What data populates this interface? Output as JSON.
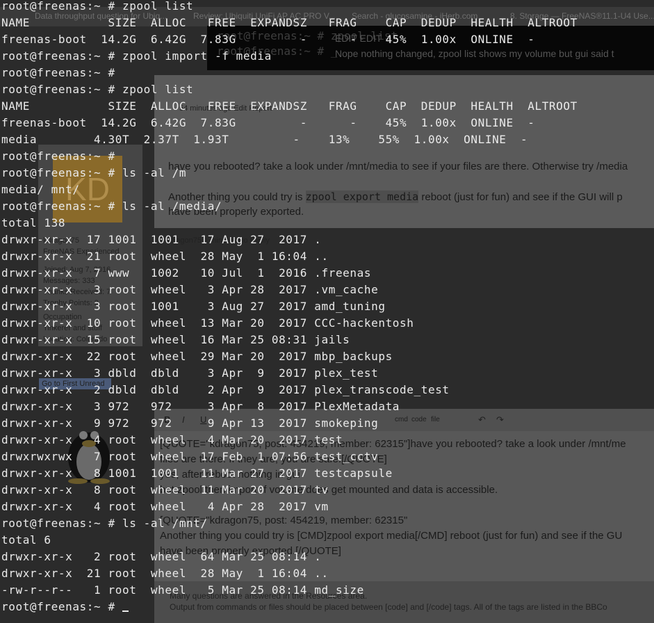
{
  "background_browser": {
    "tabs": [
      "Data throughput question for Ubiq...",
      "Review: Ubiquiti UniFi AP AC PRO V...",
      "Search - glucosamine - iHerb.com",
      "8. Storage — FreeNAS®11.1-U4 Use..."
    ],
    "code_box_lines": [
      "root@freenas:~ # zpool list",
      "root@freenas:~ # _"
    ],
    "edit_note": {
      "title": "EDIT EDIT",
      "text": "Nope nothing changed, zpool list shows my volume but gui said t"
    },
    "post_meta_1": "54 minutes ago  Edit  Report",
    "reply_1": "have you rebooted? take a look under /mnt/media to see if your files are there. Otherwise try /media",
    "reply_2_prefix": "Another thing you could try is",
    "reply_2_code": "zpool export media",
    "reply_2_suffix": "reboot (just for fun) and see if the GUI will p",
    "reply_2_line2": "have been properly exported.",
    "post_meta_2": "kdragon75  1 minute ago  Reply",
    "user_panel": {
      "avatar_letters": "KD",
      "username": "kdragon75",
      "rank": "FreeNAS Experienced",
      "joined": "Joined: Aug 7, 2016",
      "messages": "Messages: 333",
      "thanks": "Thanks Received: 7",
      "trophy": "Trophy Points: 3",
      "occupation": "Occupation",
      "hobby": "Tinkerer and stuff",
      "location": "Location: Colorado"
    },
    "goto_first_unread": "Go to First Unread",
    "editor_toolbar": [
      "B",
      "I",
      "U",
      "cmd",
      "code",
      "file"
    ],
    "editor_lines": [
      "[QUOTE=\"kdragon75, post: 454219, member: 62315\"]have you rebooted? take a look under /mnt/me",
      "files are there. If they are, you are safe.[/QUOTE]",
      "yes, after reboot nothing in gui",
      "but zpool then import -f volume does get mounted and data is accessible.",
      "[QUOTE=\"kdragon75, post: 454219, member: 62315\"",
      "Another thing you could try is [CMD]zpool export media[/CMD] reboot (just for fun) and see if the GU",
      "have been properly exported.[/QUOTE]"
    ],
    "footer_lines": [
      "Many questions are answered in the Resources area.",
      "Output from commands or files should be placed between [code] and [/code] tags. All of the tags are listed in the BBCo"
    ]
  },
  "terminal": {
    "lines": [
      "root@freenas:~ # zpool list",
      "NAME           SIZE  ALLOC   FREE  EXPANDSZ   FRAG    CAP  DEDUP  HEALTH  ALTROOT",
      "freenas-boot  14.2G  6.42G  7.83G         -      -    45%  1.00x  ONLINE  -",
      "root@freenas:~ # zpool import -f media",
      "root@freenas:~ #",
      "root@freenas:~ # zpool list",
      "NAME           SIZE  ALLOC   FREE  EXPANDSZ   FRAG    CAP  DEDUP  HEALTH  ALTROOT",
      "freenas-boot  14.2G  6.42G  7.83G         -      -    45%  1.00x  ONLINE  -",
      "media        4.30T  2.37T  1.93T         -    13%    55%  1.00x  ONLINE  -",
      "root@freenas:~ #",
      "root@freenas:~ # ls -al /m",
      "media/ mnt/",
      "root@freenas:~ # ls -al /media/",
      "total 138",
      "drwxr-xr-x  17 1001  1001   17 Aug 27  2017 .",
      "drwxr-xr-x  21 root  wheel  28 May  1 16:04 ..",
      "drwxr-xr-x   7 www   1002   10 Jul  1  2016 .freenas",
      "drwxr-xr-x   3 root  wheel   3 Apr 28  2017 .vm_cache",
      "drwxr-xr-x   3 root  1001    3 Aug 27  2017 amd_tuning",
      "drwxr-xr-x  10 root  wheel  13 Mar 20  2017 CCC-hackentosh",
      "drwxr-xr-x  15 root  wheel  16 Mar 25 08:31 jails",
      "drwxr-xr-x  22 root  wheel  29 Mar 20  2017 mbp_backups",
      "drwxr-xr-x   3 dbld  dbld    3 Apr  9  2017 plex_test",
      "drwxr-xr-x   2 dbld  dbld    2 Apr  9  2017 plex_transcode_test",
      "drwxr-xr-x   3 972   972     3 Apr  8  2017 PlexMetadata",
      "drwxr-xr-x   9 972   972     9 Apr 13  2017 smokeping",
      "drwxr-xr-x   4 root  wheel   4 Mar 20  2017 test",
      "drwxrwxrwx   7 root  wheel  17 Feb  1 07:56 test_cctv",
      "drwxr-xr-x   8 1001  1001   11 Mar 27  2017 testcapsule",
      "drwxr-xr-x   8 root  wheel  11 Mar 20  2017 tv",
      "drwxr-xr-x   4 root  wheel   4 Apr 28  2017 vm",
      "root@freenas:~ # ls -al /mnt/",
      "total 6",
      "drwxr-xr-x   2 root  wheel  64 Mar 25 08:14 .",
      "drwxr-xr-x  21 root  wheel  28 May  1 16:04 ..",
      "-rw-r--r--   1 root  wheel   5 Mar 25 08:14 md_size",
      "root@freenas:~ #"
    ]
  }
}
